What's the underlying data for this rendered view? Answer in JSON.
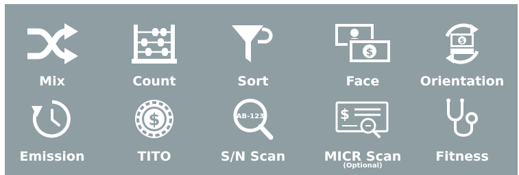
{
  "colors": {
    "panel_bg": "#8e9ea3",
    "icon": "#ffffff",
    "text": "#ffffff"
  },
  "features": [
    {
      "id": "mix",
      "label": "Mix",
      "icon": "shuffle-icon"
    },
    {
      "id": "count",
      "label": "Count",
      "icon": "abacus-icon"
    },
    {
      "id": "sort",
      "label": "Sort",
      "icon": "funnel-icon"
    },
    {
      "id": "face",
      "label": "Face",
      "icon": "banknote-face-icon"
    },
    {
      "id": "orientation",
      "label": "Orientation",
      "icon": "banknote-rotate-icon"
    },
    {
      "id": "emission",
      "label": "Emission",
      "icon": "clock-rotate-icon"
    },
    {
      "id": "tito",
      "label": "TITO",
      "icon": "dollar-chip-icon"
    },
    {
      "id": "sn-scan",
      "label": "S/N Scan",
      "icon": "magnifier-serial-icon",
      "magnifier_text": "AB-123"
    },
    {
      "id": "micr-scan",
      "label": "MICR Scan",
      "sublabel": "(Optional)",
      "icon": "cheque-magnifier-icon"
    },
    {
      "id": "fitness",
      "label": "Fitness",
      "icon": "stethoscope-icon"
    }
  ]
}
